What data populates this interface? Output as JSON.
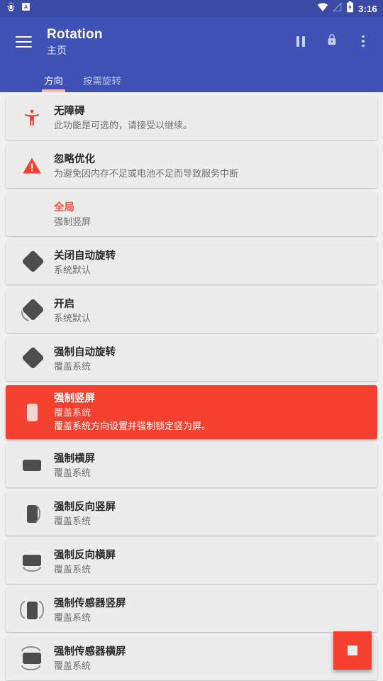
{
  "statusbar": {
    "left_icons": [
      "bug-icon",
      "letter-a-badge-icon"
    ],
    "right_icons": [
      "wifi-icon",
      "no-signal-icon",
      "battery-charging-icon"
    ],
    "time": "3:16"
  },
  "appbar": {
    "menu_icon": "hamburger-icon",
    "title": "Rotation",
    "subtitle": "主页",
    "actions": [
      {
        "name": "pause-button",
        "icon": "pause-icon"
      },
      {
        "name": "lock-button",
        "icon": "lock-icon"
      },
      {
        "name": "overflow-menu-button",
        "icon": "more-vertical-icon"
      }
    ],
    "accent_color": "#3f51b5",
    "tabs": [
      {
        "label": "方向",
        "active": true
      },
      {
        "label": "按需旋转",
        "active": false
      }
    ],
    "tab_indicator_color": "#f7b9b1"
  },
  "list": {
    "items": [
      {
        "icon": "accessibility-icon",
        "title": "无障碍",
        "subtitle": "此功能是可选的，请接受以继续。",
        "selected": false
      },
      {
        "icon": "warning-triangle-icon",
        "title": "忽略优化",
        "subtitle": "为避免因内存不足或电池不足而导致服务中断",
        "selected": false
      },
      {
        "icon": "none",
        "title": "全局",
        "subtitle": "强制竖屏",
        "title_accent": true,
        "selected": false
      },
      {
        "icon": "rotation-off-icon",
        "title": "关闭自动旋转",
        "subtitle": "系统默认",
        "selected": false
      },
      {
        "icon": "rotation-on-icon",
        "title": "开启",
        "subtitle": "系统默认",
        "selected": false
      },
      {
        "icon": "rotation-force-icon",
        "title": "强制自动旋转",
        "subtitle": "覆盖系统",
        "selected": false
      },
      {
        "icon": "phone-portrait-icon",
        "title": "强制竖屏",
        "subtitle": "覆盖系统",
        "extra": "覆盖系统方向设置并强制锁定竖为屏。",
        "selected": true
      },
      {
        "icon": "phone-landscape-icon",
        "title": "强制横屏",
        "subtitle": "覆盖系统",
        "selected": false
      },
      {
        "icon": "phone-reverse-portrait-icon",
        "title": "强制反向竖屏",
        "subtitle": "覆盖系统",
        "selected": false
      },
      {
        "icon": "phone-reverse-landscape-icon",
        "title": "强制反向横屏",
        "subtitle": "覆盖系统",
        "selected": false
      },
      {
        "icon": "sensor-portrait-icon",
        "title": "强制传感器竖屏",
        "subtitle": "覆盖系统",
        "selected": false
      },
      {
        "icon": "sensor-landscape-icon",
        "title": "强制传感器横屏",
        "subtitle": "覆盖系统",
        "selected": false
      }
    ],
    "selected_color": "#f4402e",
    "accent_text_color": "#f4533c",
    "card_color": "#ececec"
  },
  "fab": {
    "name": "stop-service-fab",
    "icon": "stop-square-icon",
    "color": "#f4402e"
  }
}
